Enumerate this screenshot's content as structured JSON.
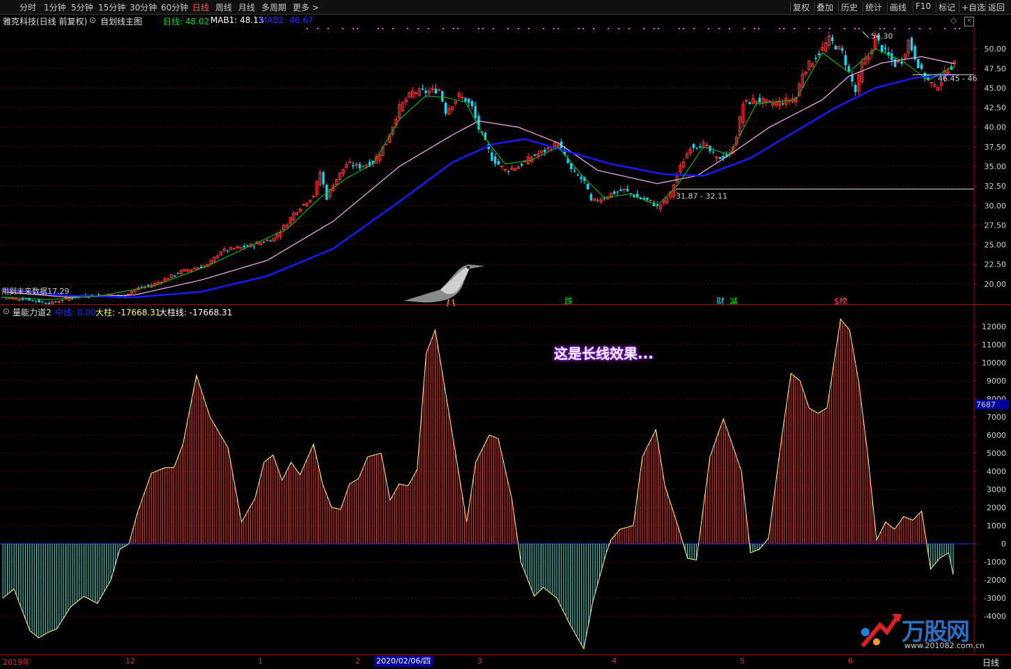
{
  "toolbar": {
    "timeframes": [
      "分时",
      "1分钟",
      "5分钟",
      "15分钟",
      "30分钟",
      "60分钟",
      "日线",
      "周线",
      "月线",
      "多周期",
      "更多 >"
    ],
    "active_timeframe": "日线",
    "right_buttons": [
      "复权",
      "叠加",
      "历史",
      "统计",
      "画线",
      "F10",
      "标记",
      "+自选",
      "返回"
    ]
  },
  "main_info": {
    "stock_name": "雅克科技",
    "mode": "(日线 前复权)",
    "indicator_name": "自划线主图",
    "daily_label": "日线: 48.02",
    "mab1_label": "MAB1: 48.13",
    "mab2_label": "MAB2: 46.67"
  },
  "osc_info": {
    "name": "量能力道2",
    "mid_label": "中线: 0.00",
    "big_label": "大柱: -17668.31",
    "big_line_label": "大柱线: -17668.31"
  },
  "annotations": {
    "high_label": "54.30",
    "support_label": "31.87 - 32.11",
    "right_label": "46.45 - 46",
    "left_label": "用到末来数据17.29",
    "marker_1": "跌",
    "marker_2": "财",
    "marker_3": "减",
    "marker_4": "$榜",
    "caption": "这是长线效果...",
    "current_osc_value": "7687",
    "watermark_text": "万股网",
    "watermark_url": "www.201082.com.cn"
  },
  "bottom_axis": {
    "ticks": [
      "2019年",
      "12",
      "1",
      "2",
      "3",
      "4",
      "5",
      "6"
    ],
    "cursor_date": "2020/02/06/四",
    "right_label": "日线"
  },
  "colors": {
    "up": "#ff3030",
    "down": "#00e0ff",
    "ma_fast": "#00d000",
    "ma_slow": "#ffb0ff",
    "ma_long": "#1a1aff",
    "osc_pos": "#ff3020",
    "osc_neg": "#40e0d0",
    "osc_line": "#ffff80",
    "grid": "#6a0000"
  },
  "chart_data": [
    {
      "type": "candlestick",
      "title": "雅克科技 (日线 前复权)",
      "ylim": [
        17.5,
        52.5
      ],
      "y_ticks": [
        20.0,
        22.5,
        25.0,
        27.5,
        30.0,
        32.5,
        35.0,
        37.5,
        40.0,
        42.5,
        45.0,
        47.5,
        50.0
      ],
      "y_tick_labels": [
        "20.00",
        "22.50",
        "25.00",
        "27.50",
        "30.00",
        "32.50",
        "35.00",
        "37.50",
        "40.00",
        "42.50",
        "45.00",
        "47.50",
        "50.00"
      ],
      "anchors": [
        [
          0,
          18.3
        ],
        [
          8,
          18.0
        ],
        [
          14,
          17.5
        ],
        [
          20,
          18.2
        ],
        [
          26,
          18.5
        ],
        [
          32,
          18.6
        ],
        [
          36,
          18.4
        ],
        [
          40,
          19.3
        ],
        [
          46,
          20.0
        ],
        [
          50,
          20.8
        ],
        [
          54,
          21.6
        ],
        [
          58,
          22.0
        ],
        [
          62,
          22.4
        ],
        [
          66,
          24.2
        ],
        [
          70,
          24.5
        ],
        [
          74,
          24.8
        ],
        [
          78,
          25.3
        ],
        [
          82,
          25.8
        ],
        [
          86,
          27.8
        ],
        [
          88,
          29.0
        ],
        [
          90,
          29.8
        ],
        [
          94,
          31.3
        ],
        [
          96,
          34.3
        ],
        [
          98,
          31.0
        ],
        [
          100,
          32.8
        ],
        [
          104,
          35.3
        ],
        [
          108,
          35.0
        ],
        [
          112,
          35.5
        ],
        [
          116,
          38.0
        ],
        [
          120,
          42.5
        ],
        [
          124,
          44.5
        ],
        [
          128,
          44.5
        ],
        [
          132,
          44.8
        ],
        [
          134,
          42.0
        ],
        [
          136,
          43.0
        ],
        [
          138,
          44.0
        ],
        [
          140,
          43.5
        ],
        [
          142,
          42.5
        ],
        [
          144,
          39.8
        ],
        [
          146,
          38.0
        ],
        [
          148,
          36.0
        ],
        [
          152,
          34.5
        ],
        [
          156,
          35.0
        ],
        [
          160,
          36.2
        ],
        [
          164,
          37.0
        ],
        [
          168,
          38.0
        ],
        [
          172,
          34.5
        ],
        [
          176,
          33.0
        ],
        [
          178,
          30.5
        ],
        [
          182,
          31.0
        ],
        [
          184,
          31.5
        ],
        [
          188,
          32.0
        ],
        [
          192,
          31.0
        ],
        [
          196,
          30.5
        ],
        [
          198,
          29.8
        ],
        [
          200,
          30.5
        ],
        [
          202,
          31.5
        ],
        [
          204,
          34.0
        ],
        [
          208,
          37.5
        ],
        [
          212,
          37.8
        ],
        [
          216,
          36.0
        ],
        [
          220,
          36.5
        ],
        [
          222,
          39.0
        ],
        [
          224,
          43.0
        ],
        [
          228,
          43.5
        ],
        [
          232,
          43.0
        ],
        [
          236,
          43.2
        ],
        [
          240,
          43.8
        ],
        [
          242,
          47.0
        ],
        [
          244,
          48.0
        ],
        [
          248,
          50.0
        ],
        [
          250,
          51.2
        ],
        [
          254,
          49.5
        ],
        [
          256,
          47.0
        ],
        [
          258,
          44.5
        ],
        [
          260,
          48.0
        ],
        [
          262,
          49.0
        ],
        [
          264,
          51.5
        ],
        [
          266,
          50.0
        ],
        [
          268,
          49.0
        ],
        [
          270,
          48.0
        ],
        [
          272,
          48.5
        ],
        [
          274,
          51.0
        ],
        [
          276,
          49.0
        ],
        [
          278,
          47.0
        ],
        [
          280,
          46.0
        ],
        [
          282,
          45.0
        ],
        [
          284,
          46.0
        ],
        [
          286,
          47.5
        ],
        [
          288,
          48.0
        ]
      ],
      "n_bars": 289,
      "ma_fast_anchors": [
        [
          0,
          18.3
        ],
        [
          14,
          18.0
        ],
        [
          30,
          18.5
        ],
        [
          46,
          19.8
        ],
        [
          62,
          22.3
        ],
        [
          74,
          24.7
        ],
        [
          86,
          27.0
        ],
        [
          96,
          31.0
        ],
        [
          104,
          33.5
        ],
        [
          112,
          35.3
        ],
        [
          120,
          41.0
        ],
        [
          128,
          44.0
        ],
        [
          134,
          43.8
        ],
        [
          140,
          43.2
        ],
        [
          146,
          38.5
        ],
        [
          152,
          35.3
        ],
        [
          160,
          35.8
        ],
        [
          168,
          37.5
        ],
        [
          176,
          33.5
        ],
        [
          182,
          31.0
        ],
        [
          190,
          31.5
        ],
        [
          198,
          30.0
        ],
        [
          204,
          32.5
        ],
        [
          212,
          37.5
        ],
        [
          220,
          36.5
        ],
        [
          228,
          43.0
        ],
        [
          240,
          43.5
        ],
        [
          248,
          49.5
        ],
        [
          256,
          47.0
        ],
        [
          264,
          50.0
        ],
        [
          272,
          48.5
        ],
        [
          280,
          46.0
        ],
        [
          288,
          47.8
        ]
      ],
      "ma_slow_anchors": [
        [
          0,
          19.0
        ],
        [
          20,
          18.3
        ],
        [
          40,
          18.6
        ],
        [
          60,
          20.5
        ],
        [
          80,
          23.0
        ],
        [
          100,
          28.0
        ],
        [
          120,
          35.0
        ],
        [
          136,
          39.0
        ],
        [
          144,
          40.8
        ],
        [
          156,
          40.0
        ],
        [
          168,
          38.0
        ],
        [
          180,
          34.5
        ],
        [
          198,
          32.8
        ],
        [
          210,
          33.8
        ],
        [
          220,
          36.5
        ],
        [
          232,
          40.0
        ],
        [
          248,
          43.5
        ],
        [
          256,
          46.5
        ],
        [
          266,
          48.2
        ],
        [
          278,
          49.0
        ],
        [
          288,
          48.1
        ]
      ],
      "ma_long_anchors": [
        [
          0,
          19.3
        ],
        [
          20,
          18.5
        ],
        [
          40,
          18.3
        ],
        [
          60,
          19.0
        ],
        [
          80,
          21.0
        ],
        [
          100,
          24.5
        ],
        [
          120,
          30.5
        ],
        [
          136,
          35.5
        ],
        [
          148,
          37.8
        ],
        [
          158,
          38.5
        ],
        [
          170,
          37.0
        ],
        [
          184,
          35.3
        ],
        [
          200,
          34.0
        ],
        [
          212,
          33.8
        ],
        [
          226,
          36.0
        ],
        [
          240,
          39.5
        ],
        [
          252,
          42.5
        ],
        [
          264,
          45.0
        ],
        [
          276,
          46.3
        ],
        [
          288,
          46.7
        ]
      ],
      "annotations": [
        "54.30",
        "31.87 - 32.11",
        "46.45 - 46"
      ]
    },
    {
      "type": "bar",
      "title": "量能力道2",
      "ylim": [
        -5800,
        12800
      ],
      "y_ticks": [
        -4000,
        -3000,
        -2000,
        -1000,
        0,
        1000,
        2000,
        3000,
        4000,
        5000,
        6000,
        7000,
        8000,
        9000,
        10000,
        11000,
        12000
      ],
      "anchors": [
        [
          0,
          -3000
        ],
        [
          5,
          -2500
        ],
        [
          12,
          -4800
        ],
        [
          16,
          -5200
        ],
        [
          20,
          -4900
        ],
        [
          24,
          -4700
        ],
        [
          30,
          -3500
        ],
        [
          36,
          -2900
        ],
        [
          42,
          -3300
        ],
        [
          48,
          -2000
        ],
        [
          52,
          -300
        ],
        [
          56,
          0
        ],
        [
          60,
          1800
        ],
        [
          66,
          3900
        ],
        [
          72,
          4200
        ],
        [
          76,
          4200
        ],
        [
          80,
          5500
        ],
        [
          86,
          9300
        ],
        [
          92,
          7000
        ],
        [
          100,
          5300
        ],
        [
          106,
          1200
        ],
        [
          112,
          2500
        ],
        [
          116,
          4500
        ],
        [
          120,
          4900
        ],
        [
          124,
          3500
        ],
        [
          128,
          4500
        ],
        [
          132,
          3800
        ],
        [
          138,
          5500
        ],
        [
          142,
          3300
        ],
        [
          146,
          2000
        ],
        [
          150,
          1900
        ],
        [
          154,
          3300
        ],
        [
          158,
          3600
        ],
        [
          162,
          4800
        ],
        [
          168,
          5000
        ],
        [
          172,
          2400
        ],
        [
          176,
          3300
        ],
        [
          180,
          3200
        ],
        [
          184,
          4100
        ],
        [
          188,
          10500
        ],
        [
          192,
          11800
        ],
        [
          198,
          7300
        ],
        [
          206,
          1200
        ],
        [
          210,
          4500
        ],
        [
          216,
          6000
        ],
        [
          220,
          5800
        ],
        [
          226,
          2500
        ],
        [
          230,
          -1000
        ],
        [
          236,
          -2900
        ],
        [
          240,
          -2400
        ],
        [
          246,
          -3000
        ],
        [
          252,
          -4500
        ],
        [
          258,
          -5800
        ],
        [
          262,
          -3200
        ],
        [
          268,
          -500
        ],
        [
          270,
          200
        ],
        [
          274,
          800
        ],
        [
          280,
          1000
        ],
        [
          284,
          4800
        ],
        [
          290,
          6300
        ],
        [
          294,
          3200
        ],
        [
          300,
          900
        ],
        [
          304,
          -800
        ],
        [
          308,
          -900
        ],
        [
          314,
          4800
        ],
        [
          320,
          6900
        ],
        [
          328,
          4000
        ],
        [
          332,
          -500
        ],
        [
          336,
          -300
        ],
        [
          340,
          300
        ],
        [
          346,
          6000
        ],
        [
          350,
          9400
        ],
        [
          354,
          9000
        ],
        [
          358,
          7500
        ],
        [
          362,
          7200
        ],
        [
          366,
          7500
        ],
        [
          372,
          12400
        ],
        [
          376,
          11800
        ],
        [
          380,
          9000
        ],
        [
          384,
          5000
        ],
        [
          388,
          200
        ],
        [
          392,
          1200
        ],
        [
          396,
          800
        ],
        [
          400,
          1500
        ],
        [
          404,
          1300
        ],
        [
          408,
          1800
        ],
        [
          412,
          -1400
        ],
        [
          416,
          -800
        ],
        [
          420,
          -500
        ],
        [
          422,
          -1700
        ]
      ],
      "n_bars": 423,
      "current_value": "7687"
    }
  ]
}
